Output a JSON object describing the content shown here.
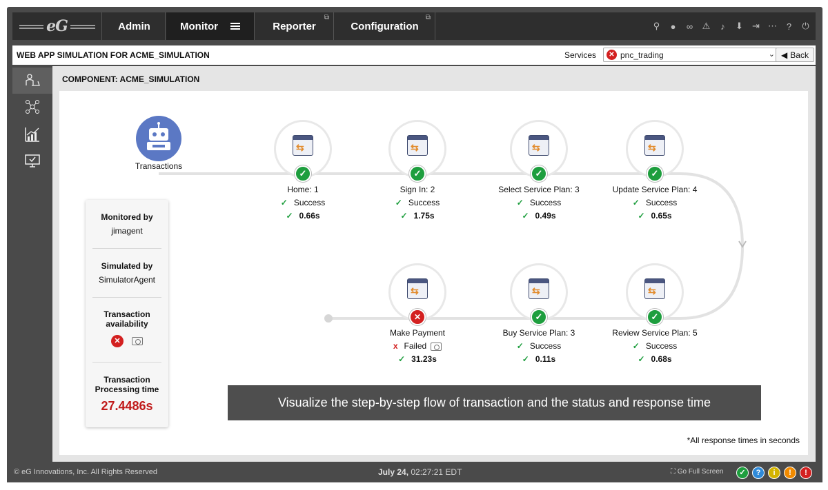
{
  "nav": {
    "logo": "eG",
    "tabs": [
      {
        "label": "Admin"
      },
      {
        "label": "Monitor"
      },
      {
        "label": "Reporter"
      },
      {
        "label": "Configuration"
      }
    ]
  },
  "header": {
    "title": "WEB APP SIMULATION FOR ACME_SIMULATION",
    "services_label": "Services",
    "service_value": "pnc_trading",
    "back_label": "Back"
  },
  "main": {
    "component_title": "COMPONENT: ACME_SIMULATION",
    "start_label": "Transactions",
    "card": {
      "monitored_label": "Monitored by",
      "monitored_value": "jimagent",
      "simulated_label": "Simulated by",
      "simulated_value": "SimulatorAgent",
      "availability_label": "Transaction availability",
      "processing_label": "Transaction Processing time",
      "processing_value": "27.4486s"
    },
    "steps": [
      {
        "name": "Home: 1",
        "status": "Success",
        "time": "0.66s",
        "ok": true
      },
      {
        "name": "Sign In: 2",
        "status": "Success",
        "time": "1.75s",
        "ok": true
      },
      {
        "name": "Select Service Plan: 3",
        "status": "Success",
        "time": "0.49s",
        "ok": true
      },
      {
        "name": "Update Service Plan: 4",
        "status": "Success",
        "time": "0.65s",
        "ok": true
      },
      {
        "name": "Review Service Plan: 5",
        "status": "Success",
        "time": "0.68s",
        "ok": true
      },
      {
        "name": "Buy Service Plan: 3",
        "status": "Success",
        "time": "0.11s",
        "ok": true
      },
      {
        "name": "Make Payment",
        "status": "Failed",
        "time": "31.23s",
        "ok": false
      }
    ],
    "banner": "Visualize the step-by-step flow of transaction and the status and response time",
    "note": "*All response times in seconds"
  },
  "footer": {
    "copyright": "© eG Innovations, Inc. All Rights Reserved",
    "date": "July 24,",
    "time": "02:27:21 EDT",
    "fullscreen": "Go Full Screen"
  },
  "colors": {
    "success": "#1e9e3e",
    "failure": "#d32020",
    "accent": "#5b78c4"
  }
}
